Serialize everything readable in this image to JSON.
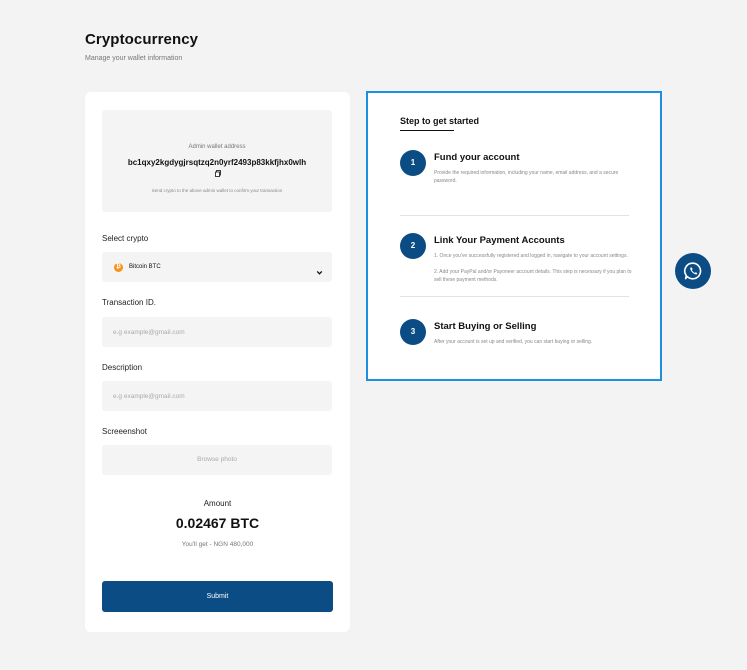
{
  "header": {
    "title": "Cryptocurrency",
    "subtitle": "Manage your wallet information"
  },
  "wallet": {
    "label": "Admin wallet address",
    "address": "bc1qxy2kgdygjrsqtzq2n0yrf2493p83kkfjhx0wlh",
    "note": "Send crypto to the above admin wallet to confirm your transaction"
  },
  "form": {
    "select_crypto_label": "Select crypto",
    "select_crypto_value": "Bitcoin BTC",
    "transaction_label": "Transaction ID.",
    "transaction_placeholder": "e.g example@gmail.com",
    "description_label": "Description",
    "description_placeholder": "e.g example@gmail.com",
    "screenshot_label": "Screeenshot",
    "screenshot_browse": "Browse photo",
    "amount_label": "Amount",
    "amount_value": "0.02467 BTC",
    "amount_get": "You'll get - NGN 480,000",
    "submit_label": "Submit"
  },
  "steps": {
    "title": "Step to get started",
    "items": [
      {
        "number": "1",
        "title": "Fund your account",
        "desc": "Provide the required information, including your name, email address, and a secure password."
      },
      {
        "number": "2",
        "title": "Link Your Payment Accounts",
        "desc1": "1. Once you've successfully registered and logged in, navigate to your account settings.",
        "desc2": "2. Add your PayPal and/or Payoneer account details. This step is necessary if you plan to sell these payment methods."
      },
      {
        "number": "3",
        "title": "Start Buying or Selling",
        "desc": "After your account is set up and verified, you can start buying or selling."
      }
    ]
  },
  "icons": {
    "crypto": "bitcoin-icon",
    "copy": "copy-icon",
    "dropdown": "chevron-down-icon",
    "chat": "whatsapp-icon"
  },
  "colors": {
    "primary": "#0b4c85",
    "highlight_border": "#1e8fe0",
    "bitcoin": "#f7931a"
  }
}
